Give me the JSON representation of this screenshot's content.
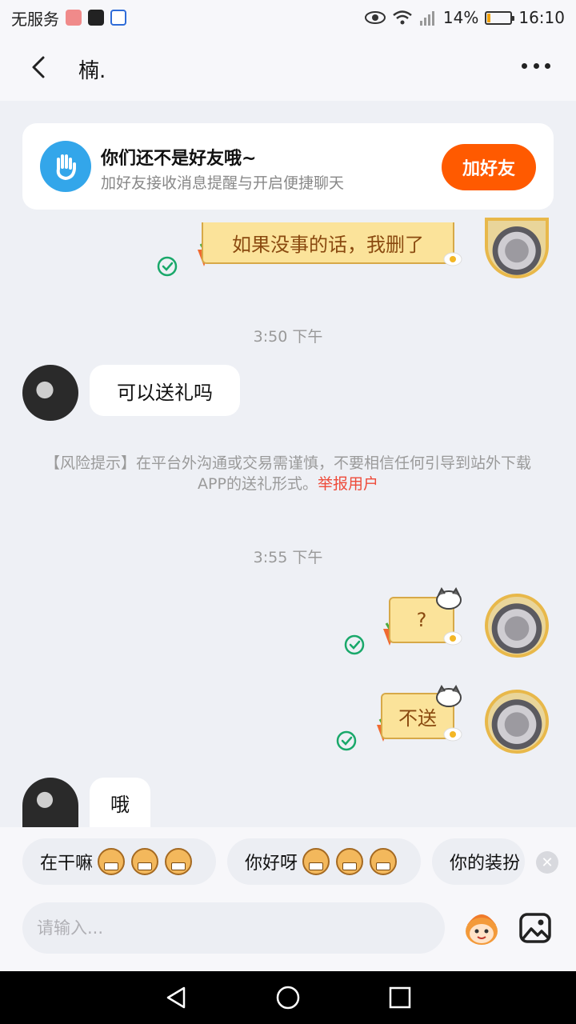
{
  "status_bar": {
    "carrier": "无服务",
    "battery_percent": "14%",
    "battery_level": 0.14,
    "time": "16:10"
  },
  "header": {
    "back_icon": "chevron-left-icon",
    "title": "楠.",
    "more_icon": "more-dots-icon"
  },
  "friend_card": {
    "icon": "hand-wave-icon",
    "title": "你们还不是好友哦~",
    "subtitle": "加好友接收消息提醒与开启便捷聊天",
    "button_label": "加好友",
    "button_color": "#ff5a00"
  },
  "messages": [
    {
      "side": "right",
      "text": "如果没事的话，我删了",
      "read": true
    },
    {
      "type": "time",
      "text": "3:50 下午"
    },
    {
      "side": "left",
      "text": "可以送礼吗"
    },
    {
      "type": "risk",
      "text": "【风险提示】在平台外沟通或交易需谨慎，不要相信任何引导到站外下载APP的送礼形式。",
      "link": "举报用户"
    },
    {
      "type": "time",
      "text": "3:55 下午"
    },
    {
      "side": "right",
      "text": "?",
      "read": true
    },
    {
      "side": "right",
      "text": "不送",
      "read": true
    },
    {
      "side": "left",
      "text": "哦"
    }
  ],
  "quick_replies": [
    {
      "text": "在干嘛"
    },
    {
      "text": "你好呀"
    },
    {
      "text": "你的装扮"
    }
  ],
  "input": {
    "placeholder": "请输入...",
    "value": ""
  },
  "colors": {
    "accent": "#ff5a00",
    "read_check": "#19a86a",
    "report_link": "#ee4b3a",
    "background": "#eef0f5"
  }
}
